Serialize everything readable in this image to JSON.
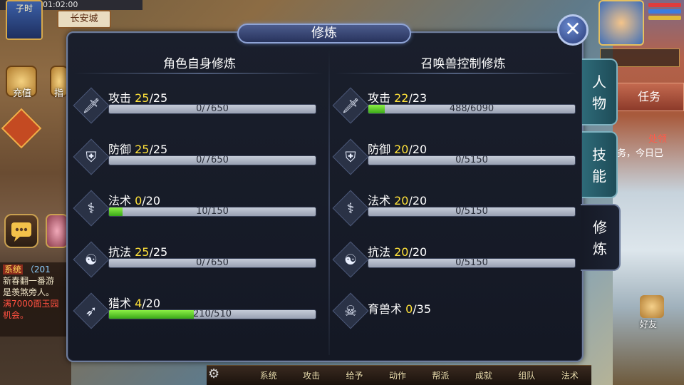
{
  "panel": {
    "title": "修炼",
    "close_label": "✕"
  },
  "tabs": [
    {
      "label": "人物",
      "active": false
    },
    {
      "label": "技能",
      "active": false
    },
    {
      "label": "修炼",
      "active": true
    }
  ],
  "left_column": {
    "header": "角色自身修炼",
    "stats": [
      {
        "icon": "sword-icon",
        "name": "攻击",
        "current": "25",
        "max": "/25",
        "progress_text": "0/7650",
        "progress": 0
      },
      {
        "icon": "shield-icon",
        "name": "防御",
        "current": "25",
        "max": "/25",
        "progress_text": "0/7650",
        "progress": 0
      },
      {
        "icon": "magic-staff-icon",
        "name": "法术",
        "current": "0",
        "max": "/20",
        "progress_text": "10/150",
        "progress": 0.067
      },
      {
        "icon": "yin-yang-icon",
        "name": "抗法",
        "current": "25",
        "max": "/25",
        "progress_text": "0/7650",
        "progress": 0
      },
      {
        "icon": "bow-icon",
        "name": "猎术",
        "current": "4",
        "max": "/20",
        "progress_text": "210/510",
        "progress": 0.412
      }
    ]
  },
  "right_column": {
    "header": "召唤兽控制修炼",
    "stats": [
      {
        "icon": "sword-icon",
        "name": "攻击",
        "current": "22",
        "max": "/23",
        "progress_text": "488/6090",
        "progress": 0.08
      },
      {
        "icon": "shield-icon",
        "name": "防御",
        "current": "20",
        "max": "/20",
        "progress_text": "0/5150",
        "progress": 0
      },
      {
        "icon": "magic-staff-icon",
        "name": "法术",
        "current": "20",
        "max": "/20",
        "progress_text": "0/5150",
        "progress": 0
      },
      {
        "icon": "yin-yang-icon",
        "name": "抗法",
        "current": "20",
        "max": "/20",
        "progress_text": "0/5150",
        "progress": 0
      },
      {
        "icon": "beast-skull-icon",
        "name": "育兽术",
        "current": "0",
        "max": "/35",
        "progress_text": null,
        "progress": null
      }
    ]
  },
  "background_ui": {
    "time": "01:02:00",
    "hour_label": "子时",
    "city": "长安城",
    "recharge_label": "充值",
    "guide_label": "指",
    "task_button": "任务",
    "task_text_1": "处领",
    "task_text_2": "务，今日已",
    "friend_label": "好友",
    "chat_lines": [
      "系统",
      "（201",
      "新春翻一番游",
      "是羡煞旁人。",
      "满7000面玉园",
      "机会。"
    ],
    "bottom_menu": [
      "系统",
      "攻击",
      "给予",
      "动作",
      "帮派",
      "成就",
      "组队",
      "法术"
    ]
  }
}
